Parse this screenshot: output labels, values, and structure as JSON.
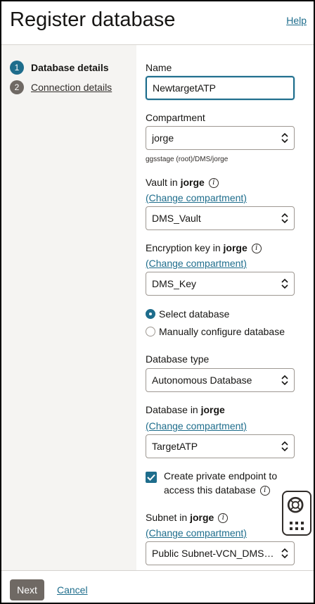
{
  "header": {
    "title": "Register database",
    "help_label": "Help"
  },
  "steps": [
    {
      "number": "1",
      "label": "Database details"
    },
    {
      "number": "2",
      "label": "Connection details"
    }
  ],
  "form": {
    "name": {
      "label": "Name",
      "value": "NewtargetATP"
    },
    "compartment": {
      "label": "Compartment",
      "value": "jorge",
      "path": "ggsstage (root)/DMS/jorge"
    },
    "vault": {
      "label_prefix": "Vault in",
      "label_compartment": "jorge",
      "change_link": "(Change compartment)",
      "value": "DMS_Vault"
    },
    "encryption_key": {
      "label_prefix": "Encryption key in",
      "label_compartment": "jorge",
      "change_link": "(Change compartment)",
      "value": "DMS_Key"
    },
    "mode": {
      "option_select": "Select database",
      "option_manual": "Manually configure database"
    },
    "database_type": {
      "label": "Database type",
      "value": "Autonomous Database"
    },
    "database": {
      "label_prefix": "Database in",
      "label_compartment": "jorge",
      "change_link": "(Change compartment)",
      "value": "TargetATP"
    },
    "private_endpoint": {
      "line1": "Create private endpoint to",
      "line2": "access this database"
    },
    "subnet": {
      "label_prefix": "Subnet in",
      "label_compartment": "jorge",
      "change_link": "(Change compartment)",
      "value": "Public Subnet-VCN_DMS_..."
    }
  },
  "footer": {
    "next_label": "Next",
    "cancel_label": "Cancel"
  },
  "icons": {
    "info": "info-icon",
    "chevron": "up-down-chevron-icon",
    "help_widget": "lifebuoy-icon",
    "apps": "app-grid-icon"
  },
  "colors": {
    "accent": "#1e6d8c",
    "button": "#6f6964"
  }
}
